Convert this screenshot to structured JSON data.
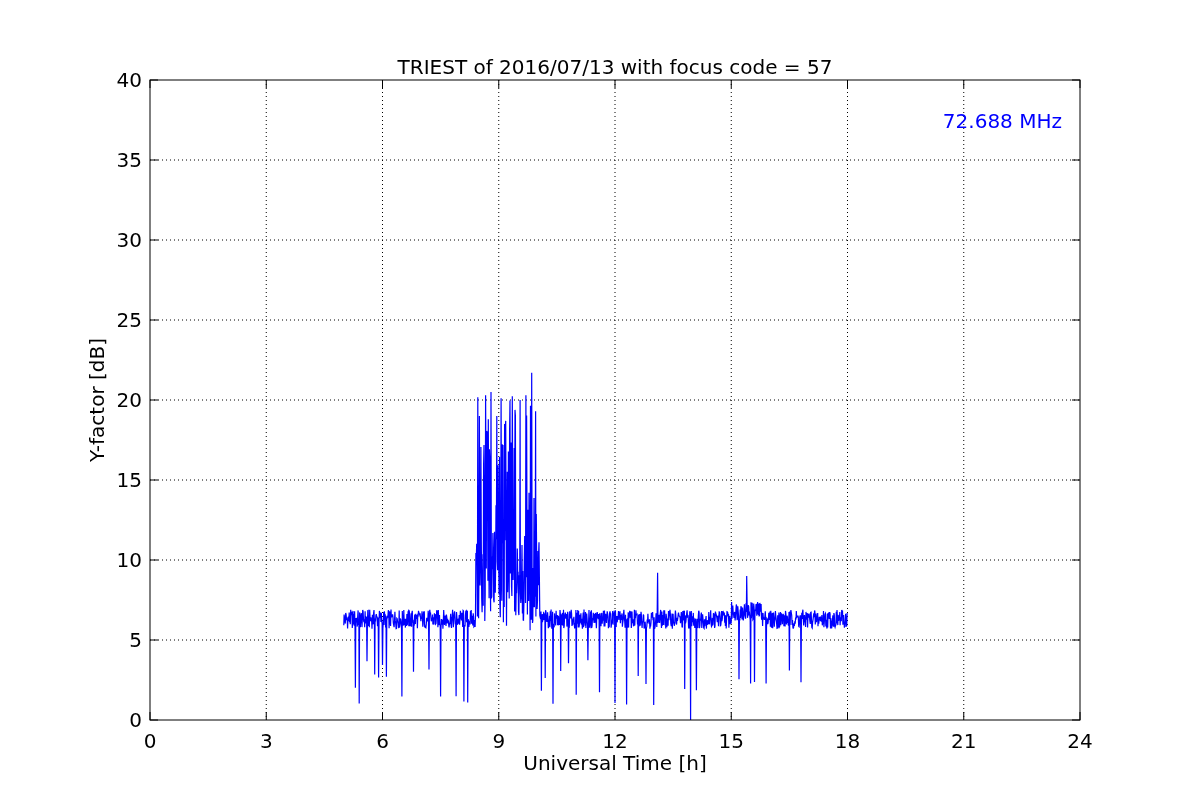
{
  "figure": {
    "title": "TRIEST of 2016/07/13 with focus code = 57",
    "xlabel": "Universal Time [h]",
    "ylabel": "Y-factor [dB]",
    "annotation": "72.688 MHz",
    "xticks": [
      "0",
      "3",
      "6",
      "9",
      "12",
      "15",
      "18",
      "21",
      "24"
    ],
    "yticks": [
      "40",
      "35",
      "30",
      "25",
      "20",
      "15",
      "10",
      "5",
      "0"
    ]
  }
}
